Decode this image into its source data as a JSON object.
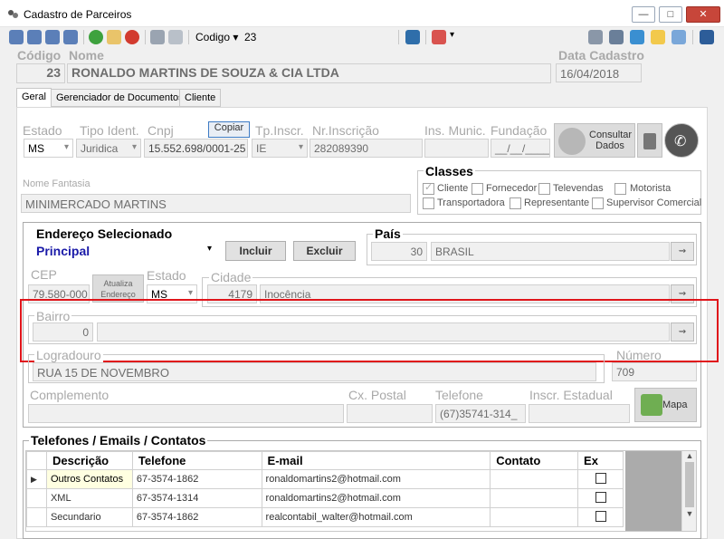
{
  "window": {
    "title": "Cadastro de Parceiros"
  },
  "toolbar": {
    "field_label": "Codigo",
    "field_value": "23"
  },
  "header": {
    "codigo_label": "Código",
    "codigo_value": "23",
    "nome_label": "Nome",
    "nome_value": "RONALDO MARTINS DE SOUZA & CIA LTDA",
    "data_label": "Data Cadastro",
    "data_value": "16/04/2018"
  },
  "tabs": [
    {
      "label": "Geral"
    },
    {
      "label": "Gerenciador de Documentos"
    },
    {
      "label": "Cliente"
    }
  ],
  "geral": {
    "estado_label": "Estado",
    "estado_value": "MS",
    "tipo_label": "Tipo Ident.",
    "tipo_value": "Juridica",
    "cnpj_label": "Cnpj",
    "cnpj_value": "15.552.698/0001-25",
    "copiar_label": "Copiar",
    "tpinscr_label": "Tp.Inscr.",
    "tpinscr_value": "IE",
    "nrinscr_label": "Nr.Inscrição",
    "nrinscr_value": "282089390",
    "insmunic_label": "Ins. Munic.",
    "insmunic_value": "",
    "fundacao_label": "Fundação",
    "fundacao_value": "__/__/____",
    "consultar_label": "Consultar Dados",
    "fantasia_label": "Nome Fantasia",
    "fantasia_value": "MINIMERCADO MARTINS"
  },
  "classes": {
    "title": "Classes",
    "items": [
      {
        "label": "Cliente",
        "checked": true
      },
      {
        "label": "Fornecedor",
        "checked": false
      },
      {
        "label": "Televendas",
        "checked": false
      },
      {
        "label": "Motorista",
        "checked": false
      },
      {
        "label": "Transportadora",
        "checked": false
      },
      {
        "label": "Representante",
        "checked": false
      },
      {
        "label": "Supervisor Comercial",
        "checked": false
      }
    ]
  },
  "endereco": {
    "title": "Endereço Selecionado",
    "selected": "Principal",
    "incluir_label": "Incluir",
    "excluir_label": "Excluir",
    "pais_label": "País",
    "pais_code": "30",
    "pais_name": "BRASIL",
    "cep_label": "CEP",
    "cep_value": "79.580-000",
    "atualiza_label": "Atualiza Endereço",
    "estado_label": "Estado",
    "estado_value": "MS",
    "cidade_label": "Cidade",
    "cidade_code": "4179",
    "cidade_name": "Inocência",
    "bairro_label": "Bairro",
    "bairro_code": "0",
    "bairro_name": "",
    "logradouro_label": "Logradouro",
    "logradouro_value": "RUA 15 DE NOVEMBRO",
    "numero_label": "Número",
    "numero_value": "709",
    "complemento_label": "Complemento",
    "complemento_value": "",
    "cxpostal_label": "Cx. Postal",
    "cxpostal_value": "",
    "telefone_label": "Telefone",
    "telefone_value": "(67)35741-314_",
    "inscr_label": "Inscr. Estadual",
    "inscr_value": "",
    "mapa_label": "Mapa"
  },
  "contatos": {
    "title": "Telefones / Emails / Contatos",
    "columns": [
      "Descrição",
      "Telefone",
      "E-mail",
      "Contato",
      "Ex"
    ],
    "rows": [
      {
        "descricao": "Outros Contatos",
        "telefone": "67-3574-1862",
        "email": "ronaldomartins2@hotmail.com",
        "contato": ""
      },
      {
        "descricao": "XML",
        "telefone": "67-3574-1314",
        "email": "ronaldomartins2@hotmail.com",
        "contato": ""
      },
      {
        "descricao": "Secundario",
        "telefone": "67-3574-1862",
        "email": "realcontabil_walter@hotmail.com",
        "contato": ""
      }
    ]
  }
}
